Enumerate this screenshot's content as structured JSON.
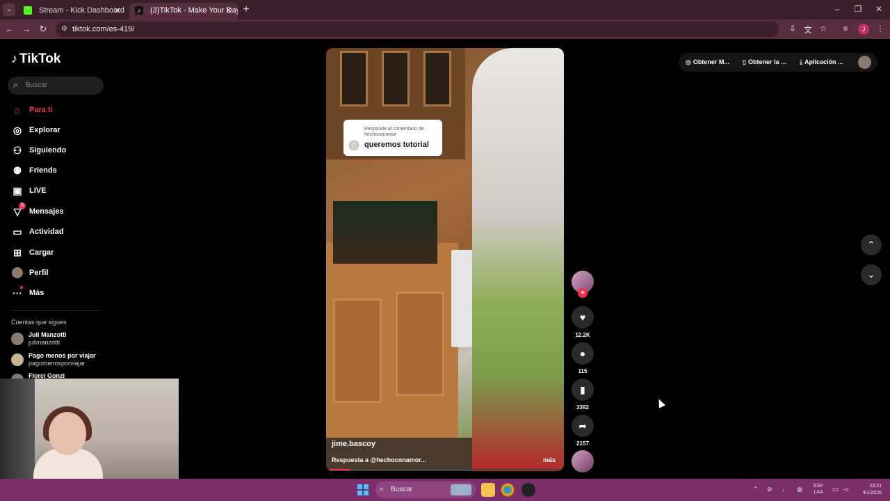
{
  "browser": {
    "tabs": [
      {
        "label": "Stream - Kick Dashboard",
        "favicon_color": "#53fc18"
      },
      {
        "label": "(3)TikTok - Make Your Day",
        "favicon_color": "#111111"
      }
    ],
    "url": "tiktok.com/es-419/"
  },
  "sidebar": {
    "logo": "TikTok",
    "search_placeholder": "Buscar",
    "nav": [
      {
        "label": "Para ti",
        "icon": "home-icon",
        "active": true
      },
      {
        "label": "Explorar",
        "icon": "compass-icon"
      },
      {
        "label": "Siguiendo",
        "icon": "following-icon"
      },
      {
        "label": "Friends",
        "icon": "friends-icon"
      },
      {
        "label": "LIVE",
        "icon": "live-icon"
      },
      {
        "label": "Mensajes",
        "icon": "messages-icon",
        "badge": "3"
      },
      {
        "label": "Actividad",
        "icon": "activity-icon"
      },
      {
        "label": "Cargar",
        "icon": "upload-icon"
      },
      {
        "label": "Perfil",
        "icon": "profile-avatar"
      },
      {
        "label": "Más",
        "icon": "more-icon"
      }
    ],
    "following_title": "Cuentas que sigues",
    "following": [
      {
        "name": "Juli Manzotti",
        "user": "julimanzotti"
      },
      {
        "name": "Pago menos por viajar",
        "user": "pagomenosporviajar"
      },
      {
        "name": "Florci Gonzi",
        "user": ""
      }
    ]
  },
  "video": {
    "reply_header": "Responde al comentario de hechoconamor",
    "reply_text": "queremos tutorial",
    "author": "jime.bascoy",
    "description": "Respuesta a @hechoconamor...",
    "more_label": "más",
    "progress": 0.09
  },
  "actions": {
    "likes": "12.2K",
    "comments": "115",
    "saves": "3392",
    "shares": "2157"
  },
  "topright": {
    "item1": "Obtener M...",
    "item2": "Obtener la ...",
    "item3": "Aplicación ..."
  },
  "taskbar": {
    "search_placeholder": "Buscar",
    "lang_top": "ESP",
    "lang_bottom": "LAA",
    "time": "23:21",
    "date": "4/1/2026"
  },
  "colors": {
    "accent": "#fe2c55",
    "chrome_tabbar": "#3b1f2a",
    "taskbar": "#7a2e6a"
  }
}
